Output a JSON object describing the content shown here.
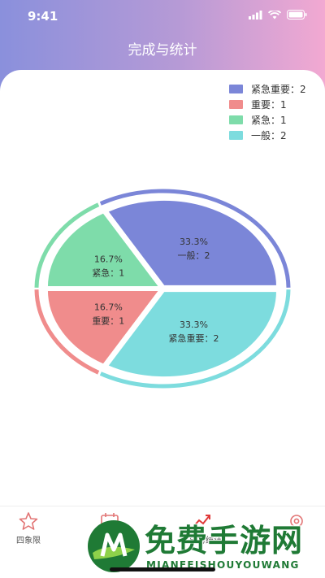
{
  "status_bar": {
    "time": "9:41"
  },
  "header": {
    "title": "完成与统计"
  },
  "legend": [
    {
      "label": "紧急重要：2",
      "color": "#7b86d8"
    },
    {
      "label": "重要：1",
      "color": "#f08c8c"
    },
    {
      "label": "紧急：1",
      "color": "#7edcaa"
    },
    {
      "label": "一般：2",
      "color": "#7ddcde"
    }
  ],
  "chart_data": {
    "type": "pie",
    "slices": [
      {
        "label": "一般",
        "value": 2,
        "percent_label": "33.3%",
        "count_label": "一般：2",
        "color": "#7b86d8"
      },
      {
        "label": "紧急重要",
        "value": 2,
        "percent_label": "33.3%",
        "count_label": "紧急重要：2",
        "color": "#7ddcde"
      },
      {
        "label": "重要",
        "value": 1,
        "percent_label": "16.7%",
        "count_label": "重要：1",
        "color": "#f08c8c"
      },
      {
        "label": "紧急",
        "value": 1,
        "percent_label": "16.7%",
        "count_label": "紧急：1",
        "color": "#7edcaa"
      }
    ],
    "legend_position": "top-right"
  },
  "tabbar": {
    "items": [
      {
        "label": "四象限",
        "icon": "star-icon"
      },
      {
        "label": "",
        "icon": "calendar-icon"
      },
      {
        "label": "完成与统计",
        "icon": "trend-icon"
      },
      {
        "label": "",
        "icon": "settings-icon"
      }
    ]
  },
  "watermark": {
    "cn": "免费手游网",
    "en": "MIANFEISHOUYOUWANG"
  }
}
